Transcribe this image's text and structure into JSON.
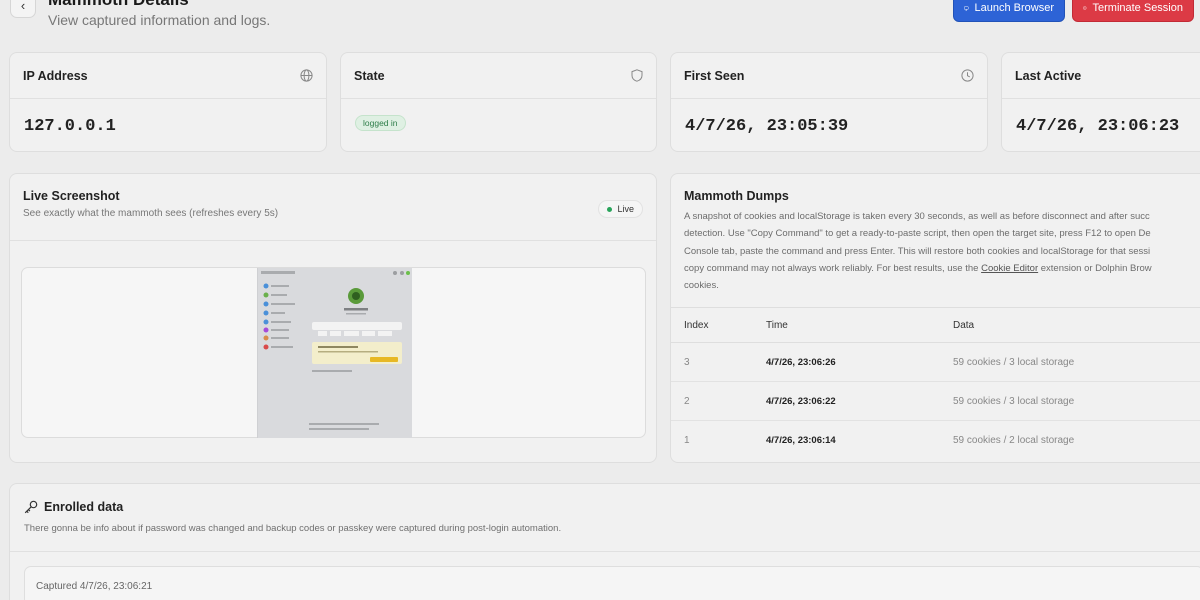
{
  "header": {
    "back_icon": "chevron-left-icon",
    "title": "Mammoth Details",
    "subtitle": "View captured information and logs.",
    "launch_label": "Launch Browser",
    "launch_icon": "monitor-icon",
    "terminate_label": "Terminate Session",
    "terminate_icon": "x-circle-icon"
  },
  "stats": {
    "ip": {
      "label": "IP Address",
      "value": "127.0.0.1",
      "icon": "globe-icon"
    },
    "state": {
      "label": "State",
      "value": "logged in",
      "icon": "shield-icon"
    },
    "first_seen": {
      "label": "First Seen",
      "value": "4/7/26, 23:05:39",
      "icon": "clock-icon"
    },
    "last_active": {
      "label": "Last Active",
      "value": "4/7/26, 23:06:23"
    }
  },
  "screenshot": {
    "title": "Live Screenshot",
    "subtitle": "See exactly what the mammoth sees (refreshes every 5s)",
    "live_label": "Live"
  },
  "dumps": {
    "title": "Mammoth Dumps",
    "desc_lines": [
      "A snapshot of cookies and localStorage is taken every 30 seconds, as well as before disconnect and after succ",
      "detection. Use \"Copy Command\" to get a ready-to-paste script, then open the target site, press F12 to open De",
      "Console tab, paste the command and press Enter. This will restore both cookies and localStorage for that sessi"
    ],
    "desc_line4_pre": "copy command may not always work reliably. For best results, use the ",
    "desc_link": "Cookie Editor",
    "desc_line4_post": " extension or Dolphin Brow",
    "desc_line5": "cookies.",
    "columns": [
      "Index",
      "Time",
      "Data"
    ],
    "rows": [
      {
        "index": "3",
        "time": "4/7/26, 23:06:26",
        "data": "59 cookies / 3 local storage"
      },
      {
        "index": "2",
        "time": "4/7/26, 23:06:22",
        "data": "59 cookies / 3 local storage"
      },
      {
        "index": "1",
        "time": "4/7/26, 23:06:14",
        "data": "59 cookies / 2 local storage"
      }
    ]
  },
  "enrolled": {
    "icon": "key-icon",
    "title": "Enrolled data",
    "subtitle": "There gonna be info about if password was changed and backup codes or passkey were captured during post-login automation.",
    "captured": "Captured 4/7/26, 23:06:21"
  },
  "colors": {
    "launch": "#2d63d6",
    "terminate": "#dc3a45",
    "live_dot": "#28a45a",
    "state_badge": "#2e7d49"
  }
}
